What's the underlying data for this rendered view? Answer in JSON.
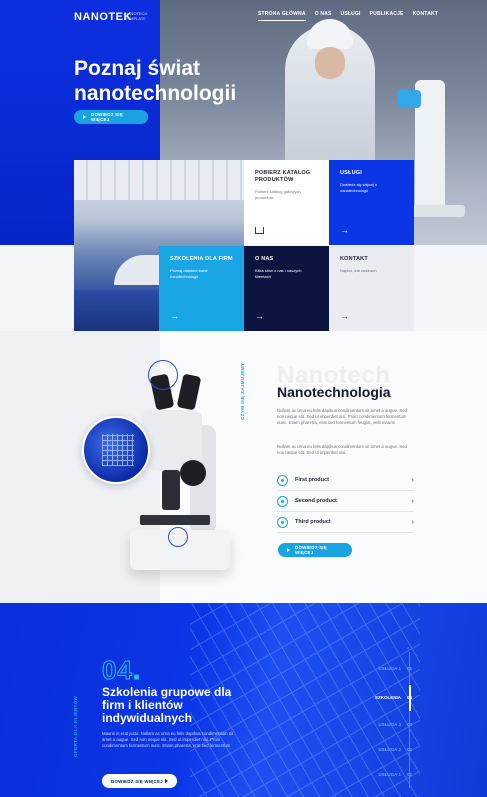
{
  "brand": {
    "name": "NANOTEK",
    "tagline": "NANOTECH TEMPLATE"
  },
  "nav": [
    {
      "label": "STRONA GŁÓWNA",
      "active": true
    },
    {
      "label": "O NAS",
      "active": false
    },
    {
      "label": "USŁUGI",
      "active": false
    },
    {
      "label": "PUBLIKACJE",
      "active": false
    },
    {
      "label": "KONTAKT",
      "active": false
    }
  ],
  "hero": {
    "title": "Poznaj świat nanotechnologii",
    "button": "DOWIEDZ SIĘ WIĘCEJ"
  },
  "tiles": [
    {
      "title": "POBIERZ KATALOG PRODUKTÓW",
      "text": "Pobierz katalog gotowych produktów",
      "icon": "download-icon"
    },
    {
      "title": "USŁUGI",
      "text": "Dowiedz się więcej o nanotechnologii",
      "icon": "arrow-right-icon"
    },
    {
      "title": "SZKOLENIA DLA FIRM",
      "text": "Poznaj ostatnie świat nanotechnologii",
      "icon": "arrow-right-icon"
    },
    {
      "title": "O NAS",
      "text": "Kilka słów o nas i naszych klientach",
      "icon": "arrow-right-icon"
    },
    {
      "title": "KONTAKT",
      "text": "Napisz, lub zadzwoń",
      "icon": "arrow-right-icon"
    }
  ],
  "nano": {
    "side_label": "CZYM SIĘ ZAJMUJEMY",
    "ghost": "Nanotech",
    "title": "Nanotechnologia",
    "p1": "Nullam ac urna eu felis dapibus condimentum sit amet a augue. Sed non neque elit. Sed ut imperdiet nisi. Proin condimentum fermentum nunc. Etiam pharetra, erat sed fermentum feugiat, velit mauris",
    "p2": "Nullam ac urna eu felis dapibus condimentum sit amet a augue. Sed non neque elit. Sed ut imperdiet nisi.",
    "products": [
      "First product",
      "Second product",
      "Third product"
    ],
    "button": "DOWIEDZ SIĘ WIĘCEJ"
  },
  "offer": {
    "side_label": "OFERTA DLA KLIENTÓW",
    "number": "04",
    "title": "Szkolenia grupowe dla firm i klientów indywidualnych",
    "text": "Mauris in erat justo. Nullam ac urna eu felis dapibus condimentum sit amet a augue. Sed non neque elit. Sed ut imperdiet nisi. Proin condimentum fermentum nunc. Etiam pharetra, erat sed fermentum",
    "button": "DOWIEDZ SIĘ WIĘCEJ",
    "items": [
      {
        "label": "USŁUGA 1",
        "num": "01",
        "active": false
      },
      {
        "label": "SZKOLENIA",
        "num": "04",
        "active": true
      },
      {
        "label": "USŁUGA 3",
        "num": "03",
        "active": false
      },
      {
        "label": "USŁUGA 2",
        "num": "02",
        "active": false
      },
      {
        "label": "USŁUGA 1",
        "num": "01",
        "active": false
      }
    ]
  },
  "colors": {
    "brand_blue": "#0b36e6",
    "cyan": "#1aa6e6",
    "dark_navy": "#0c1540"
  }
}
